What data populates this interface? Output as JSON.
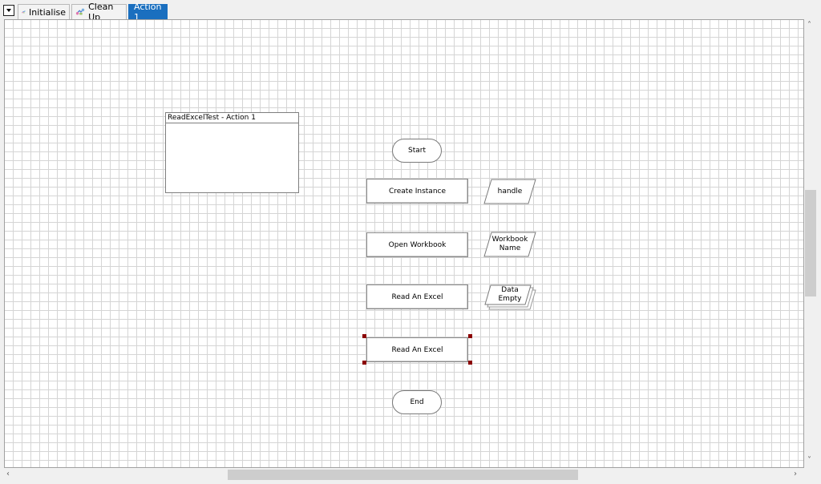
{
  "tabs": [
    {
      "label": "Initialise",
      "icon": "page-flow-icon",
      "active": false
    },
    {
      "label": "Clean Up",
      "icon": "page-flow-icon",
      "active": false
    },
    {
      "label": "Action 1",
      "icon": "",
      "active": true
    }
  ],
  "canvas": {
    "note": {
      "title": "ReadExcelTest - Action 1"
    },
    "start": {
      "label": "Start"
    },
    "end": {
      "label": "End"
    },
    "stages": [
      {
        "label": "Create Instance"
      },
      {
        "label": "Open Workbook"
      },
      {
        "label": "Read An Excel"
      },
      {
        "label": "Read An Excel",
        "selected": true
      }
    ],
    "data_items": [
      {
        "label": "handle"
      },
      {
        "label": "Workbook\nName"
      },
      {
        "label": "Data\nEmpty",
        "collection": true
      }
    ]
  },
  "colors": {
    "active_tab": "#1a6fbf",
    "grid": "#d5d5d5",
    "selection_handle": "#8b0000"
  }
}
